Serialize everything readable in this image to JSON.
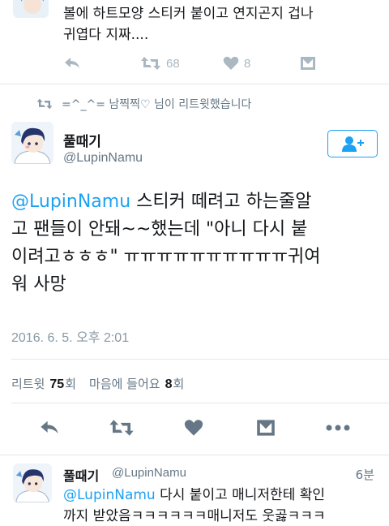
{
  "previous_tweet": {
    "text_line1": "볼에 하트모양 스티커 붙이고 연지곤지 겁나",
    "text_line2": "귀엽다 지짜....",
    "retweet_count": "68",
    "like_count": "8"
  },
  "retweet_context": {
    "text": "=^_^= 남찍찍♡ 님이 리트윗했습니다"
  },
  "tweet": {
    "display_name": "풀때기",
    "handle": "@LupinNamu",
    "mention": "@LupinNamu",
    "body_line1_rest": " 스티커 떼려고 하는줄알",
    "body_line2": "고 팬들이 안돼~~했는데 \"아니 다시 붙",
    "body_line3": "이려고ㅎㅎㅎ\" ㅠㅠㅠㅠㅠㅠㅠㅠㅠㅠ귀여",
    "body_line4": "워 사망",
    "timestamp": "2016. 6. 5. 오후 2:01",
    "stats": {
      "retweets_label": "리트윗",
      "retweets_value": "75",
      "retweets_unit": "회",
      "likes_label": "마음에 들어요",
      "likes_value": "8",
      "likes_unit": "회"
    }
  },
  "next_tweet": {
    "display_name": "풀때기",
    "handle": "@LupinNamu",
    "time": "6분",
    "mention": "@LupinNamu",
    "text_line1_rest": " 다시 붙이고 매니저한테 확인",
    "text_line2": "까지 받았음ㅋㅋㅋㅋㅋㅋ매니저도 웃곯ㅋㅋㅋ"
  },
  "colors": {
    "accent": "#1da1f2",
    "icon_gray": "#aab8c2",
    "action_gray": "#657786",
    "divider": "#e1e8ed"
  },
  "icons": [
    "reply-icon",
    "retweet-icon",
    "heart-icon",
    "direct-message-icon",
    "more-icon",
    "follow-icon",
    "avatar"
  ]
}
